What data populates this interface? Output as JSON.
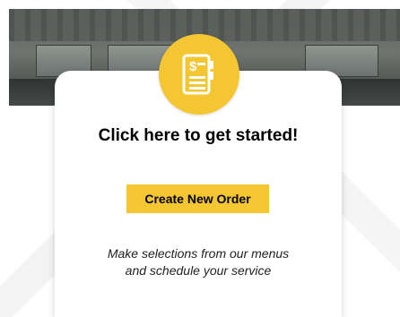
{
  "hero": {
    "image_icon": "photo-icon"
  },
  "icon": {
    "name": "order-menu-icon",
    "color": "#f4c631",
    "glyph": "$"
  },
  "card": {
    "title": "Click here to get started!",
    "button_label": "Create New Order",
    "subtitle_line1": "Make selections from our menus",
    "subtitle_line2": "and schedule your service"
  },
  "colors": {
    "accent": "#f4c631",
    "text": "#000000"
  }
}
